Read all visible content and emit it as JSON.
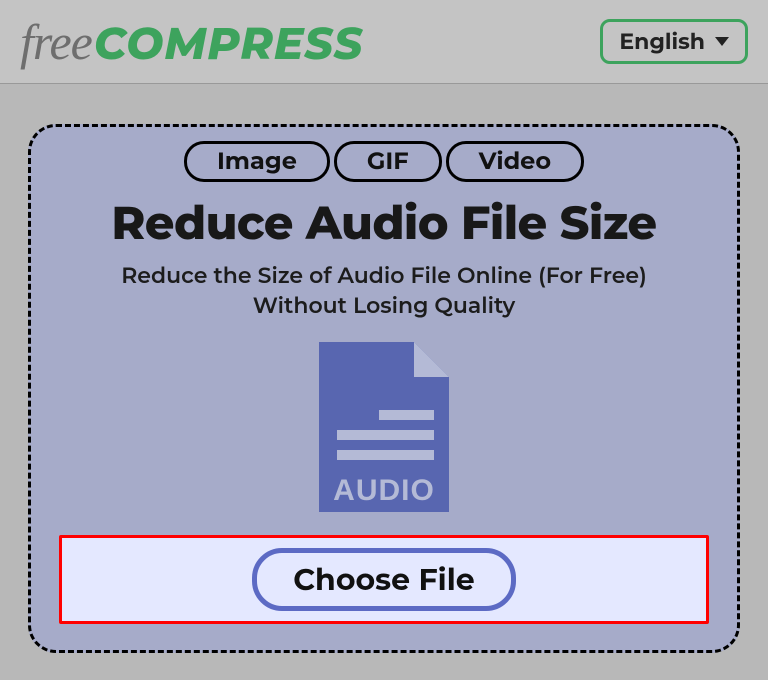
{
  "header": {
    "logo_free": "free",
    "logo_compress": "COMPRESS",
    "language_label": "English"
  },
  "tabs": {
    "image": "Image",
    "gif": "GIF",
    "video": "Video"
  },
  "main": {
    "title": "Reduce Audio File Size",
    "subtitle_line1": "Reduce the Size of Audio File Online (For Free)",
    "subtitle_line2": "Without Losing Quality",
    "file_icon_label": "AUDIO",
    "choose_file_label": "Choose File"
  }
}
